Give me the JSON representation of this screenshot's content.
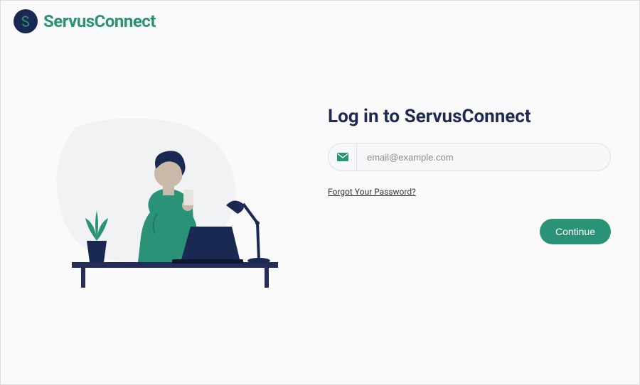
{
  "brand": {
    "name": "ServusConnect",
    "accent_color": "#2a9276",
    "logo_bg": "#1a2951"
  },
  "login": {
    "title": "Log in to ServusConnect",
    "email_placeholder": "email@example.com",
    "forgot_password_label": "Forgot Your Password?",
    "continue_label": "Continue"
  }
}
